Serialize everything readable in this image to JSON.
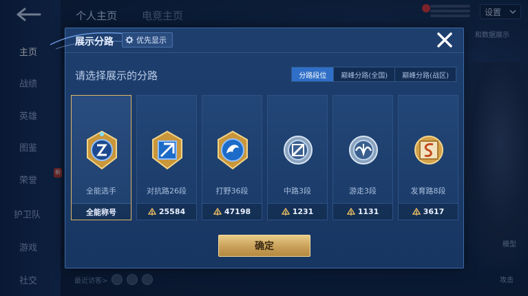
{
  "background": {
    "top_tabs": [
      "个人主页",
      "电竞主页"
    ],
    "settings_label": "设置",
    "sidebar_items": [
      {
        "label": "主页",
        "active": true
      },
      {
        "label": "战绩",
        "active": false
      },
      {
        "label": "英雄",
        "active": false
      },
      {
        "label": "图鉴",
        "active": false
      },
      {
        "label": "荣誉",
        "active": false,
        "badge": "新"
      },
      {
        "label": "护卫队",
        "active": false
      },
      {
        "label": "游戏",
        "active": false
      },
      {
        "label": "社交",
        "active": false
      }
    ],
    "right_labels": [
      "和数据展示",
      "模型",
      "攻击"
    ],
    "visitors_label": "最近访客>"
  },
  "modal": {
    "title": "展示分路",
    "priority_label": "优先显示",
    "subtitle": "请选择展示的分路",
    "tabs": [
      {
        "label": "分路段位",
        "active": true
      },
      {
        "label": "巅峰分路(全国)",
        "active": false
      },
      {
        "label": "巅峰分路(战区)",
        "active": false
      }
    ],
    "cards": [
      {
        "name": "全能选手",
        "footer": "全能称号",
        "emblem": "all-round-emblem",
        "selected": true
      },
      {
        "name": "对抗路26段",
        "footer": "25584",
        "emblem": "clash-lane-emblem",
        "selected": false
      },
      {
        "name": "打野36段",
        "footer": "47198",
        "emblem": "jungle-emblem",
        "selected": false
      },
      {
        "name": "中路3段",
        "footer": "1231",
        "emblem": "mid-lane-emblem",
        "selected": false
      },
      {
        "name": "游走3段",
        "footer": "1131",
        "emblem": "roam-emblem",
        "selected": false
      },
      {
        "name": "发育路8段",
        "footer": "3617",
        "emblem": "farm-lane-emblem",
        "selected": false
      }
    ],
    "confirm_label": "确定"
  },
  "colors": {
    "accent_blue": "#2f6fc7",
    "gold": "#e2b863",
    "modal_bg": "#1e3f6e"
  }
}
